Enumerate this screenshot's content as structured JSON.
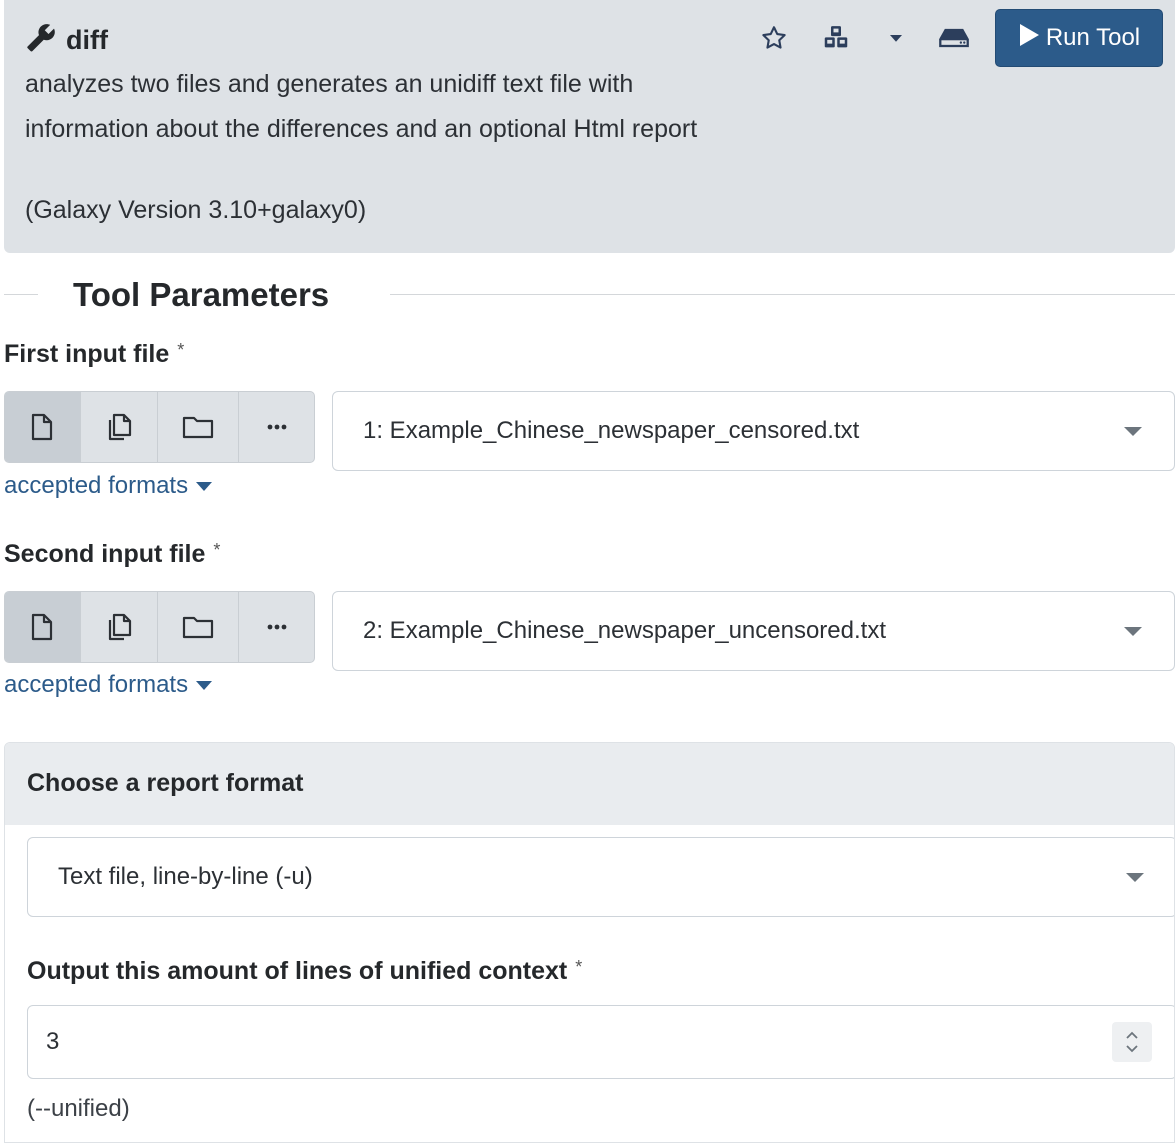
{
  "header": {
    "tool_name": "diff",
    "description": "analyzes two files and generates an unidiff text file with information about the differences and an optional Html report",
    "version": "(Galaxy Version 3.10+galaxy0)",
    "run_label": "Run Tool",
    "icons": [
      "wrench-icon",
      "star-icon",
      "cubes-icon",
      "caret-down-icon",
      "hdd-icon",
      "play-icon"
    ]
  },
  "section": {
    "title": "Tool Parameters"
  },
  "params": {
    "first": {
      "label": "First input file",
      "required_mark": "*",
      "selected": "1: Example_Chinese_newspaper_censored.txt",
      "accepted": "accepted formats"
    },
    "second": {
      "label": "Second input file",
      "required_mark": "*",
      "selected": "2: Example_Chinese_newspaper_uncensored.txt",
      "accepted": "accepted formats"
    },
    "report": {
      "heading": "Choose a report format",
      "selected": "Text file, line-by-line (-u)"
    },
    "unified": {
      "label": "Output this amount of lines of unified context",
      "required_mark": "*",
      "value": "3",
      "help": "(--unified)"
    }
  },
  "input_modes": [
    "single-dataset",
    "multiple-datasets",
    "dataset-collection",
    "more"
  ],
  "colors": {
    "header_bg": "#dee2e6",
    "run_button": "#2c5b8a",
    "link": "#2c5b8a"
  }
}
